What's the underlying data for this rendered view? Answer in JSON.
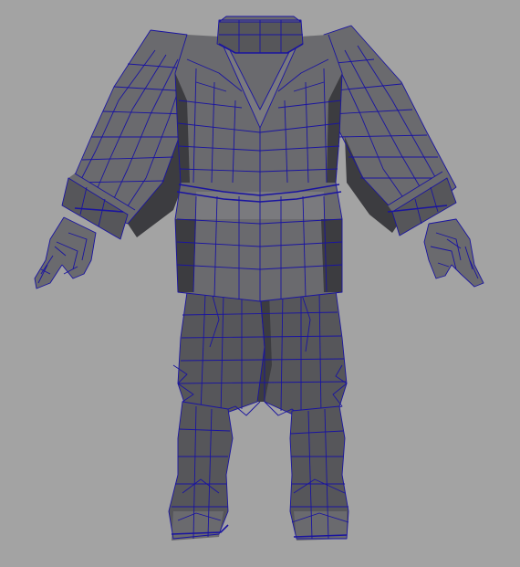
{
  "viewport": {
    "background_color": "#a3a3a3",
    "mesh_fill_color": "#5a5a5e",
    "wireframe_color": "#1a14a0",
    "display_mode": "wireframe-on-shaded"
  },
  "model": {
    "parts": [
      {
        "name": "collar",
        "icon": "collar-mesh"
      },
      {
        "name": "jacket",
        "icon": "jacket-mesh"
      },
      {
        "name": "left-sleeve",
        "icon": "sleeve-mesh"
      },
      {
        "name": "right-sleeve",
        "icon": "sleeve-mesh"
      },
      {
        "name": "left-hand",
        "icon": "hand-mesh"
      },
      {
        "name": "right-hand",
        "icon": "hand-mesh"
      },
      {
        "name": "pants",
        "icon": "pants-mesh"
      },
      {
        "name": "left-boot",
        "icon": "boot-mesh"
      },
      {
        "name": "right-boot",
        "icon": "boot-mesh"
      }
    ]
  }
}
